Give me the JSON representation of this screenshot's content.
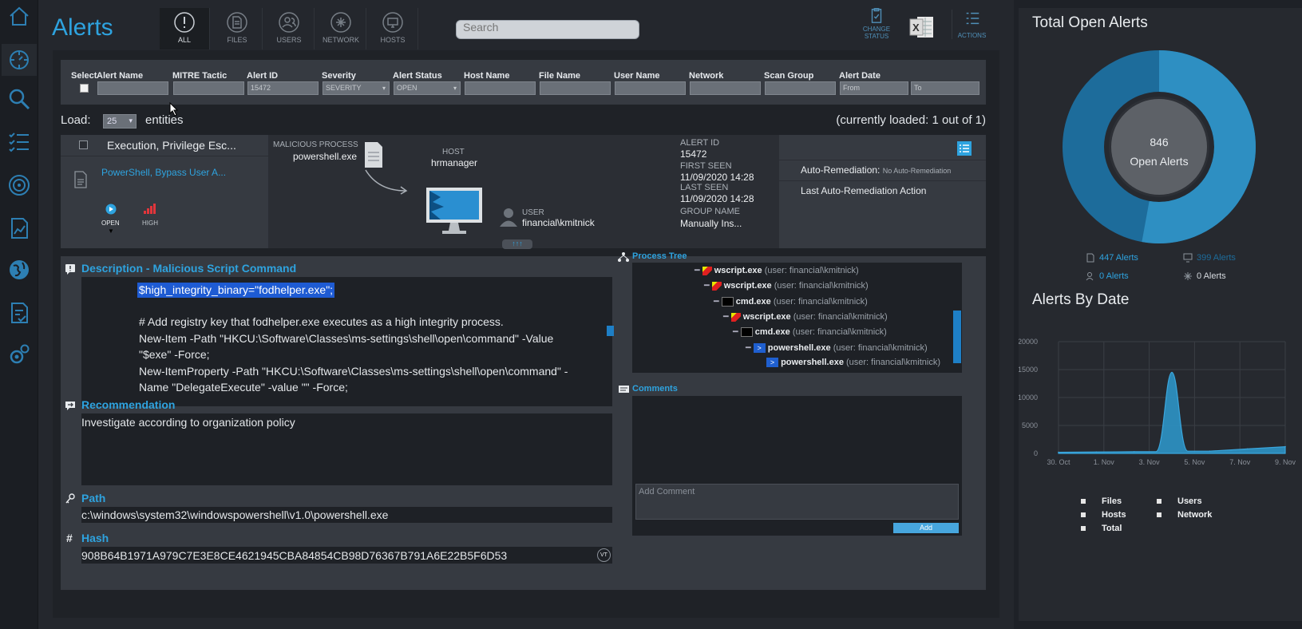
{
  "header": {
    "title": "Alerts",
    "search_placeholder": "Search",
    "tabs": [
      {
        "label": "ALL",
        "icon": "exclamation-circle-icon"
      },
      {
        "label": "FILES",
        "icon": "file-icon"
      },
      {
        "label": "USERS",
        "icon": "users-icon"
      },
      {
        "label": "NETWORK",
        "icon": "network-icon"
      },
      {
        "label": "HOSTS",
        "icon": "monitor-icon"
      }
    ],
    "change_status_label": "CHANGE STATUS",
    "actions_label": "ACTIONS"
  },
  "filters": {
    "select_label": "Select",
    "columns": [
      {
        "label": "Alert Name",
        "value": ""
      },
      {
        "label": "MITRE Tactic",
        "value": ""
      },
      {
        "label": "Alert ID",
        "value": "15472"
      },
      {
        "label": "Severity",
        "value": "SEVERITY"
      },
      {
        "label": "Alert Status",
        "value": "OPEN"
      },
      {
        "label": "Host Name",
        "value": ""
      },
      {
        "label": "File Name",
        "value": ""
      },
      {
        "label": "User Name",
        "value": ""
      },
      {
        "label": "Network",
        "value": ""
      },
      {
        "label": "Scan Group",
        "value": ""
      },
      {
        "label": "Alert Date",
        "value": "From"
      }
    ],
    "date_to_placeholder": "To"
  },
  "load": {
    "label": "Load:",
    "value": "25",
    "suffix": "entities",
    "status": "(currently loaded: 1 out of 1)"
  },
  "alert": {
    "tactic": "Execution, Privilege Esc...",
    "name": "PowerShell, Bypass User A...",
    "status": "OPEN",
    "severity": "HIGH",
    "malicious_process_label": "MALICIOUS PROCESS",
    "malicious_process": "powershell.exe",
    "host_label": "HOST",
    "host": "hrmanager",
    "user_label": "USER",
    "user": "financial\\kmitnick",
    "expand_label": "↑↑↑",
    "alert_id_label": "ALERT ID",
    "alert_id": "15472",
    "first_seen_label": "FIRST SEEN",
    "first_seen": "11/09/2020 14:28",
    "last_seen_label": "LAST SEEN",
    "last_seen": "11/09/2020 14:28",
    "group_name_label": "GROUP NAME",
    "group_name": "Manually Ins...",
    "auto_remediation_label": "Auto-Remediation:",
    "auto_remediation_value": "No Auto-Remediation",
    "last_action_label": "Last Auto-Remediation Action"
  },
  "description": {
    "title": "Description - Malicious Script Command",
    "highlighted_line": "$high_integrity_binary=\"fodhelper.exe\";",
    "lines": [
      "# Add registry key that fodhelper.exe executes as a high integrity process.",
      "New-Item -Path \"HKCU:\\Software\\Classes\\ms-settings\\shell\\open\\command\" -Value",
      "\"$exe\" -Force;",
      "New-ItemProperty -Path \"HKCU:\\Software\\Classes\\ms-settings\\shell\\open\\command\" -",
      "Name \"DelegateExecute\" -value \"\" -Force;"
    ]
  },
  "recommendation": {
    "title": "Recommendation",
    "text": "Investigate according to organization policy"
  },
  "path": {
    "title": "Path",
    "value": "c:\\windows\\system32\\windowspowershell\\v1.0\\powershell.exe"
  },
  "hash": {
    "title": "Hash",
    "value": "908B64B1971A979C7E3E8CE4621945CBA84854CB98D76367B791A6E22B5F6D53",
    "vt_label": "VT"
  },
  "process_tree": {
    "title": "Process Tree",
    "nodes": [
      {
        "name": "wscript.exe",
        "user": "(user: financial\\kmitnick)",
        "icon": "wscript-icon"
      },
      {
        "name": "wscript.exe",
        "user": "(user: financial\\kmitnick)",
        "icon": "wscript-icon"
      },
      {
        "name": "cmd.exe",
        "user": "(user: financial\\kmitnick)",
        "icon": "cmd-icon"
      },
      {
        "name": "wscript.exe",
        "user": "(user: financial\\kmitnick)",
        "icon": "wscript-icon"
      },
      {
        "name": "cmd.exe",
        "user": "(user: financial\\kmitnick)",
        "icon": "cmd-icon"
      },
      {
        "name": "powershell.exe",
        "user": "(user: financial\\kmitnick)",
        "icon": "powershell-icon"
      },
      {
        "name": "powershell.exe",
        "user": "(user: financial\\kmitnick)",
        "icon": "powershell-icon"
      }
    ]
  },
  "comments": {
    "title": "Comments",
    "placeholder": "Add Comment",
    "add_label": "Add"
  },
  "summary": {
    "title": "Total Open Alerts",
    "center_value": "846",
    "center_label": "Open Alerts",
    "file_alerts": "447 Alerts",
    "host_alerts": "399 Alerts",
    "user_alerts": "0 Alerts",
    "network_alerts": "0 Alerts"
  },
  "chart_data": {
    "type": "area",
    "title": "Alerts By Date",
    "x": [
      "30. Oct",
      "1. Nov",
      "3. Nov",
      "5. Nov",
      "7. Nov",
      "9. Nov"
    ],
    "y_ticks": [
      0,
      5000,
      10000,
      15000,
      20000
    ],
    "ylim": [
      0,
      20000
    ],
    "series": [
      {
        "name": "Files",
        "values": [
          200,
          250,
          300,
          14500,
          400,
          800,
          1200
        ]
      },
      {
        "name": "Hosts",
        "values": [
          0,
          0,
          0,
          0,
          0,
          0,
          0
        ]
      },
      {
        "name": "Total",
        "values": [
          200,
          250,
          300,
          14500,
          400,
          800,
          1200
        ]
      },
      {
        "name": "Users",
        "values": [
          0,
          0,
          0,
          0,
          0,
          0,
          0
        ]
      },
      {
        "name": "Network",
        "values": [
          0,
          0,
          0,
          0,
          0,
          0,
          0
        ]
      }
    ],
    "colors": {
      "area": "#2e94c7",
      "ring_files": "#2e8fc2",
      "ring_hosts": "#1d6c9b"
    }
  }
}
